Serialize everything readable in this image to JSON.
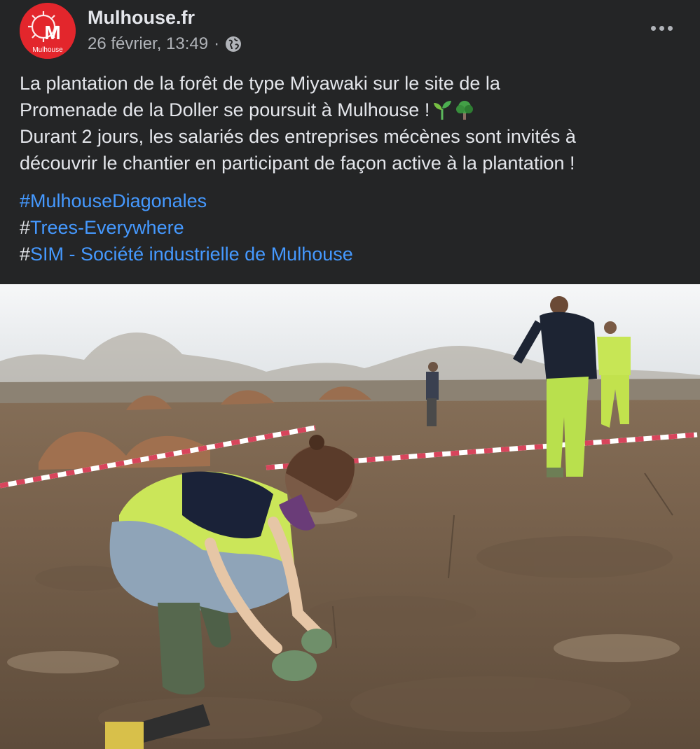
{
  "header": {
    "page_name": "Mulhouse.fr",
    "avatar_text": "M",
    "avatar_caption": "Mulhouse",
    "timestamp": "26 février, 13:49",
    "separator": "·",
    "audience_icon": "globe-icon",
    "more_icon": "more-options-icon"
  },
  "post": {
    "line1": "La plantation de la forêt de type Miyawaki sur le site de la",
    "line2": "Promenade de la Doller se poursuit à Mulhouse !",
    "emojis": [
      "seedling-icon",
      "tree-icon"
    ],
    "line3": "Durant 2 jours, les salariés des entreprises mécènes sont invités à",
    "line4": "découvrir le chantier en participant de façon active à la plantation !"
  },
  "hashtags": [
    {
      "prefix": "",
      "text": "#MulhouseDiagonales"
    },
    {
      "prefix": "#",
      "text": "Trees-Everywhere"
    },
    {
      "prefix": "#",
      "text": "SIM - Société industrielle de Mulhouse"
    }
  ],
  "colors": {
    "background": "#242526",
    "text": "#e4e6eb",
    "secondary_text": "#b0b3b8",
    "link": "#4599ff",
    "brand_red": "#e3262c"
  }
}
